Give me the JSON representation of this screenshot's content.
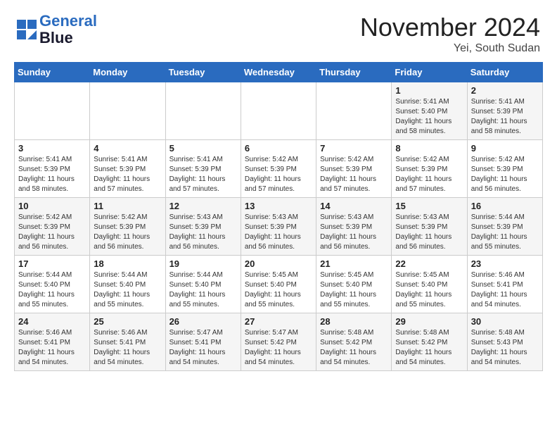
{
  "logo": {
    "line1": "General",
    "line2": "Blue"
  },
  "title": "November 2024",
  "location": "Yei, South Sudan",
  "days_of_week": [
    "Sunday",
    "Monday",
    "Tuesday",
    "Wednesday",
    "Thursday",
    "Friday",
    "Saturday"
  ],
  "weeks": [
    [
      {
        "day": "",
        "info": ""
      },
      {
        "day": "",
        "info": ""
      },
      {
        "day": "",
        "info": ""
      },
      {
        "day": "",
        "info": ""
      },
      {
        "day": "",
        "info": ""
      },
      {
        "day": "1",
        "info": "Sunrise: 5:41 AM\nSunset: 5:40 PM\nDaylight: 11 hours\nand 58 minutes."
      },
      {
        "day": "2",
        "info": "Sunrise: 5:41 AM\nSunset: 5:39 PM\nDaylight: 11 hours\nand 58 minutes."
      }
    ],
    [
      {
        "day": "3",
        "info": "Sunrise: 5:41 AM\nSunset: 5:39 PM\nDaylight: 11 hours\nand 58 minutes."
      },
      {
        "day": "4",
        "info": "Sunrise: 5:41 AM\nSunset: 5:39 PM\nDaylight: 11 hours\nand 57 minutes."
      },
      {
        "day": "5",
        "info": "Sunrise: 5:41 AM\nSunset: 5:39 PM\nDaylight: 11 hours\nand 57 minutes."
      },
      {
        "day": "6",
        "info": "Sunrise: 5:42 AM\nSunset: 5:39 PM\nDaylight: 11 hours\nand 57 minutes."
      },
      {
        "day": "7",
        "info": "Sunrise: 5:42 AM\nSunset: 5:39 PM\nDaylight: 11 hours\nand 57 minutes."
      },
      {
        "day": "8",
        "info": "Sunrise: 5:42 AM\nSunset: 5:39 PM\nDaylight: 11 hours\nand 57 minutes."
      },
      {
        "day": "9",
        "info": "Sunrise: 5:42 AM\nSunset: 5:39 PM\nDaylight: 11 hours\nand 56 minutes."
      }
    ],
    [
      {
        "day": "10",
        "info": "Sunrise: 5:42 AM\nSunset: 5:39 PM\nDaylight: 11 hours\nand 56 minutes."
      },
      {
        "day": "11",
        "info": "Sunrise: 5:42 AM\nSunset: 5:39 PM\nDaylight: 11 hours\nand 56 minutes."
      },
      {
        "day": "12",
        "info": "Sunrise: 5:43 AM\nSunset: 5:39 PM\nDaylight: 11 hours\nand 56 minutes."
      },
      {
        "day": "13",
        "info": "Sunrise: 5:43 AM\nSunset: 5:39 PM\nDaylight: 11 hours\nand 56 minutes."
      },
      {
        "day": "14",
        "info": "Sunrise: 5:43 AM\nSunset: 5:39 PM\nDaylight: 11 hours\nand 56 minutes."
      },
      {
        "day": "15",
        "info": "Sunrise: 5:43 AM\nSunset: 5:39 PM\nDaylight: 11 hours\nand 56 minutes."
      },
      {
        "day": "16",
        "info": "Sunrise: 5:44 AM\nSunset: 5:39 PM\nDaylight: 11 hours\nand 55 minutes."
      }
    ],
    [
      {
        "day": "17",
        "info": "Sunrise: 5:44 AM\nSunset: 5:40 PM\nDaylight: 11 hours\nand 55 minutes."
      },
      {
        "day": "18",
        "info": "Sunrise: 5:44 AM\nSunset: 5:40 PM\nDaylight: 11 hours\nand 55 minutes."
      },
      {
        "day": "19",
        "info": "Sunrise: 5:44 AM\nSunset: 5:40 PM\nDaylight: 11 hours\nand 55 minutes."
      },
      {
        "day": "20",
        "info": "Sunrise: 5:45 AM\nSunset: 5:40 PM\nDaylight: 11 hours\nand 55 minutes."
      },
      {
        "day": "21",
        "info": "Sunrise: 5:45 AM\nSunset: 5:40 PM\nDaylight: 11 hours\nand 55 minutes."
      },
      {
        "day": "22",
        "info": "Sunrise: 5:45 AM\nSunset: 5:40 PM\nDaylight: 11 hours\nand 55 minutes."
      },
      {
        "day": "23",
        "info": "Sunrise: 5:46 AM\nSunset: 5:41 PM\nDaylight: 11 hours\nand 54 minutes."
      }
    ],
    [
      {
        "day": "24",
        "info": "Sunrise: 5:46 AM\nSunset: 5:41 PM\nDaylight: 11 hours\nand 54 minutes."
      },
      {
        "day": "25",
        "info": "Sunrise: 5:46 AM\nSunset: 5:41 PM\nDaylight: 11 hours\nand 54 minutes."
      },
      {
        "day": "26",
        "info": "Sunrise: 5:47 AM\nSunset: 5:41 PM\nDaylight: 11 hours\nand 54 minutes."
      },
      {
        "day": "27",
        "info": "Sunrise: 5:47 AM\nSunset: 5:42 PM\nDaylight: 11 hours\nand 54 minutes."
      },
      {
        "day": "28",
        "info": "Sunrise: 5:48 AM\nSunset: 5:42 PM\nDaylight: 11 hours\nand 54 minutes."
      },
      {
        "day": "29",
        "info": "Sunrise: 5:48 AM\nSunset: 5:42 PM\nDaylight: 11 hours\nand 54 minutes."
      },
      {
        "day": "30",
        "info": "Sunrise: 5:48 AM\nSunset: 5:43 PM\nDaylight: 11 hours\nand 54 minutes."
      }
    ]
  ]
}
